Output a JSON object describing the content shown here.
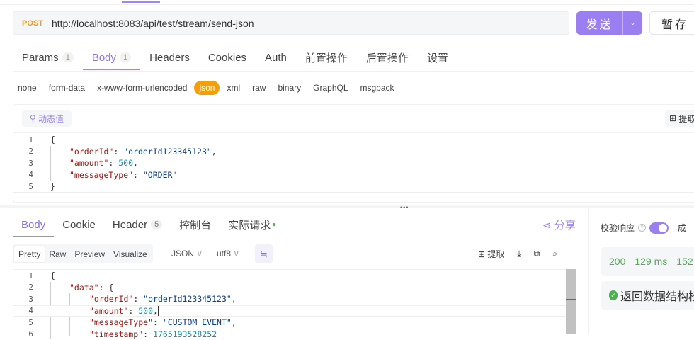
{
  "request": {
    "method": "POST",
    "url": "http://localhost:8083/api/test/stream/send-json",
    "send_label": "发送",
    "save_label": "暂存"
  },
  "tabs": [
    {
      "label": "Params",
      "badge": "1"
    },
    {
      "label": "Body",
      "badge": "1"
    },
    {
      "label": "Headers"
    },
    {
      "label": "Cookies"
    },
    {
      "label": "Auth"
    },
    {
      "label": "前置操作"
    },
    {
      "label": "后置操作"
    },
    {
      "label": "设置"
    }
  ],
  "body_types": [
    "none",
    "form-data",
    "x-www-form-urlencoded",
    "json",
    "xml",
    "raw",
    "binary",
    "GraphQL",
    "msgpack"
  ],
  "editor": {
    "dynamic_label": "动态值",
    "extract_label": "提取",
    "lines": [
      {
        "n": "1",
        "text": "{"
      },
      {
        "n": "2",
        "key": "\"orderId\"",
        "val": "\"orderId123345123\"",
        "end": ","
      },
      {
        "n": "3",
        "key": "\"amount\"",
        "num": "500",
        "end": ","
      },
      {
        "n": "4",
        "key": "\"messageType\"",
        "val": "\"ORDER\"",
        "end": ""
      },
      {
        "n": "5",
        "text": "}"
      }
    ]
  },
  "response": {
    "tabs": [
      {
        "label": "Body"
      },
      {
        "label": "Cookie"
      },
      {
        "label": "Header",
        "badge": "5"
      },
      {
        "label": "控制台"
      },
      {
        "label": "实际请求"
      }
    ],
    "share_label": "分享",
    "view_tabs": [
      "Pretty",
      "Raw",
      "Preview",
      "Visualize"
    ],
    "format": "JSON",
    "encoding": "utf8",
    "extract_label": "提取",
    "lines": [
      {
        "n": "1",
        "text": "{"
      },
      {
        "n": "2",
        "key": "\"data\"",
        "text2": ": {"
      },
      {
        "n": "3",
        "key": "\"orderId\"",
        "val": "\"orderId123345123\"",
        "end": ","
      },
      {
        "n": "4",
        "key": "\"amount\"",
        "num": "500",
        "end": ","
      },
      {
        "n": "5",
        "key": "\"messageType\"",
        "val": "\"CUSTOM_EVENT\"",
        "end": ","
      },
      {
        "n": "6",
        "key": "\"timestamp\"",
        "num": "1765193528252",
        "end": ""
      }
    ]
  },
  "side": {
    "validate_label": "校验响应",
    "status": "200",
    "time": "129 ms",
    "size": "152",
    "success_label": "成",
    "check_label": "返回数据结构校"
  }
}
